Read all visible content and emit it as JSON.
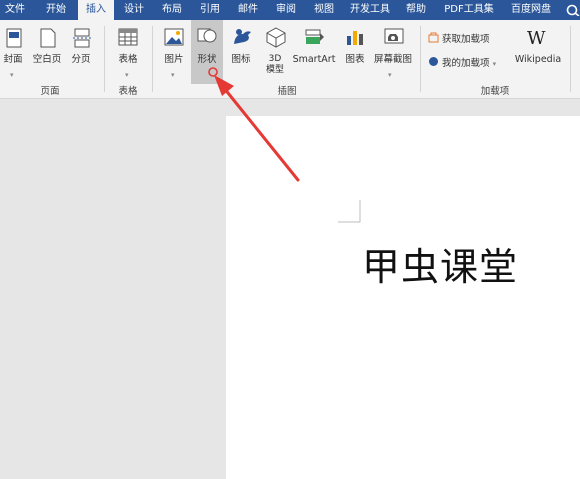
{
  "tabs": [
    "文件",
    "开始",
    "插入",
    "设计",
    "布局",
    "引用",
    "邮件",
    "审阅",
    "视图",
    "开发工具",
    "帮助",
    "PDF工具集",
    "百度网盘"
  ],
  "ribbon": {
    "pages": {
      "cover": "封面",
      "blank": "空白页",
      "break": "分页",
      "group": "页面"
    },
    "tables": {
      "table": "表格",
      "group": "表格"
    },
    "illustrations": {
      "picture": "图片",
      "shapes": "形状",
      "icons": "图标",
      "model3d": "3D模型",
      "model3d_l1": "3D",
      "model3d_l2": "模型",
      "smartart": "SmartArt",
      "chart": "图表",
      "screenshot": "屏幕截图",
      "group": "插图"
    },
    "addins": {
      "get": "获取加载项",
      "my": "我的加载项",
      "wikipedia": "Wikipedia",
      "group": "加载项"
    }
  },
  "document": {
    "text": "甲虫课堂"
  },
  "colors": {
    "accent": "#2b579a",
    "arrow": "#e53935"
  }
}
